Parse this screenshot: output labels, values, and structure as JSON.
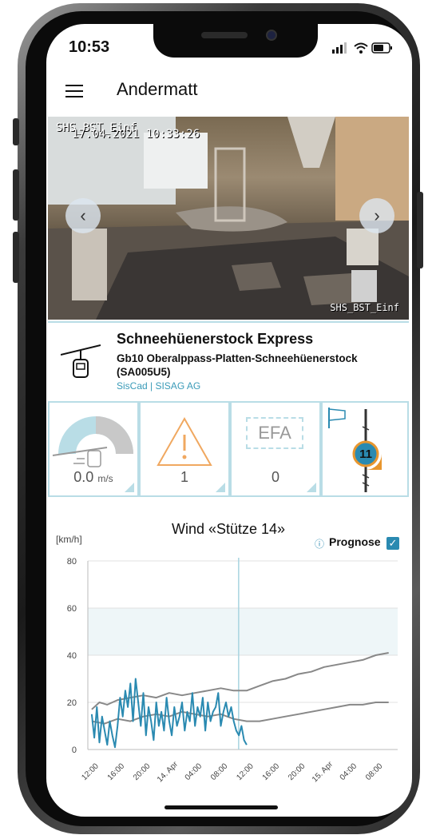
{
  "status": {
    "time": "10:53"
  },
  "header": {
    "title": "Andermatt"
  },
  "camera": {
    "label_top": "SHS_BST_Einf",
    "timestamp": "17.04.2021 10:33:26",
    "label_bottom": "SHS_BST_Einf"
  },
  "lift": {
    "name": "Schneehüenerstock Express",
    "description": "Gb10 Oberalppass-Platten-Schneehüenerstock (SA005U5)",
    "source": "SisCad | SISAG AG"
  },
  "tiles": {
    "wind_value": "0.0",
    "wind_unit": "m/s",
    "warnings_count": "1",
    "efa_label": "EFA",
    "efa_count": "0",
    "tower_number": "11"
  },
  "chart": {
    "title": "Wind «Stütze 14»",
    "unit": "[km/h]",
    "prognose_label": "Prognose",
    "prognose_checked": true
  },
  "chart_data": {
    "type": "line",
    "title": "Wind «Stütze 14»",
    "ylabel": "[km/h]",
    "ylim": [
      0,
      80
    ],
    "yticks": [
      0,
      20,
      40,
      60,
      80
    ],
    "xticks": [
      "12:00",
      "16:00",
      "20:00",
      "14. Apr",
      "04:00",
      "08:00",
      "12:00",
      "16:00",
      "20:00",
      "15. Apr",
      "04:00",
      "08:00"
    ],
    "shaded_band": [
      40,
      60
    ],
    "now_index": 6,
    "series": [
      {
        "color": "#888888",
        "x": [
          0,
          0.3,
          0.6,
          1,
          1.5,
          2,
          2.5,
          3,
          3.5,
          4,
          4.5,
          5,
          5.5,
          6,
          6.5,
          7,
          7.5,
          8,
          8.5,
          9,
          9.5,
          10,
          10.5,
          11,
          11.5
        ],
        "values": [
          17,
          20,
          19,
          21,
          22,
          23,
          22,
          24,
          23,
          24,
          25,
          26,
          25,
          25,
          27,
          29,
          30,
          32,
          33,
          35,
          36,
          37,
          38,
          40,
          41
        ]
      },
      {
        "color": "#888888",
        "x": [
          0,
          0.5,
          1,
          1.5,
          2,
          2.5,
          3,
          3.5,
          4,
          4.5,
          5,
          5.5,
          6,
          6.5,
          7,
          7.5,
          8,
          8.5,
          9,
          9.5,
          10,
          10.5,
          11,
          11.5
        ],
        "values": [
          12,
          11,
          13,
          12,
          14,
          15,
          14,
          16,
          15,
          14,
          15,
          13,
          12,
          12,
          13,
          14,
          15,
          16,
          17,
          18,
          19,
          19,
          20,
          20
        ]
      },
      {
        "color": "#2a8ab1",
        "x": [
          0,
          0.1,
          0.2,
          0.3,
          0.4,
          0.5,
          0.6,
          0.7,
          0.8,
          0.9,
          1,
          1.1,
          1.2,
          1.3,
          1.4,
          1.5,
          1.6,
          1.7,
          1.8,
          1.9,
          2,
          2.1,
          2.2,
          2.3,
          2.4,
          2.5,
          2.6,
          2.7,
          2.8,
          2.9,
          3,
          3.1,
          3.2,
          3.3,
          3.4,
          3.5,
          3.6,
          3.7,
          3.8,
          3.9,
          4,
          4.1,
          4.2,
          4.3,
          4.4,
          4.5,
          4.6,
          4.7,
          4.8,
          4.9,
          5,
          5.1,
          5.2,
          5.3,
          5.4,
          5.5,
          5.6,
          5.7,
          5.8,
          5.9,
          6
        ],
        "values": [
          15,
          5,
          18,
          3,
          14,
          8,
          2,
          12,
          6,
          1,
          10,
          22,
          14,
          25,
          18,
          28,
          12,
          30,
          20,
          10,
          24,
          6,
          18,
          12,
          4,
          20,
          10,
          16,
          8,
          22,
          12,
          6,
          18,
          10,
          14,
          20,
          8,
          16,
          12,
          24,
          10,
          18,
          14,
          22,
          8,
          20,
          12,
          16,
          18,
          24,
          10,
          16,
          20,
          14,
          18,
          12,
          8,
          6,
          10,
          4,
          2
        ]
      }
    ]
  }
}
